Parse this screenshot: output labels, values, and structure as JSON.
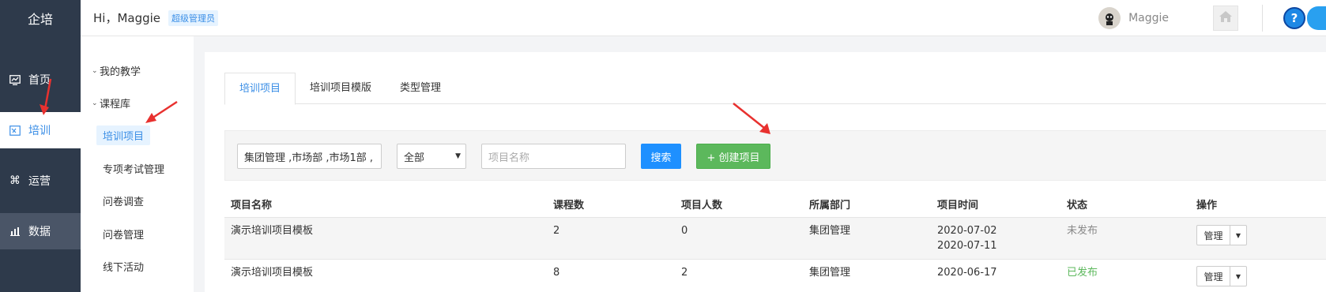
{
  "brand": "企培",
  "header": {
    "greeting": "Hi，Maggie",
    "role_badge": "超级管理员",
    "username": "Maggie"
  },
  "leftnav": {
    "items": [
      {
        "label": "首页",
        "icon": "chart-icon"
      },
      {
        "label": "培训",
        "icon": "training-icon"
      },
      {
        "label": "运营",
        "icon": "command-icon"
      },
      {
        "label": "数据",
        "icon": "bar-chart-icon"
      }
    ]
  },
  "subnav": {
    "groups": [
      "我的教学",
      "课程库"
    ],
    "items": [
      "培训项目",
      "专项考试管理",
      "问卷调查",
      "问卷管理",
      "线下活动"
    ]
  },
  "tabs": [
    "培训项目",
    "培训项目模版",
    "类型管理"
  ],
  "filters": {
    "department_value": "集团管理 ,市场部 ,市场1部 ,",
    "status_value": "全部",
    "project_name_placeholder": "项目名称",
    "search_label": "搜索",
    "create_label": "+ 创建项目"
  },
  "table": {
    "headers": [
      "项目名称",
      "课程数",
      "项目人数",
      "所属部门",
      "项目时间",
      "状态",
      "操作"
    ],
    "rows": [
      {
        "name": "演示培训项目模板",
        "courses": "2",
        "people": "0",
        "dept": "集团管理",
        "time_start": "2020-07-02",
        "time_end": "2020-07-11",
        "status": "未发布",
        "action": "管理"
      },
      {
        "name": "演示培训项目模板",
        "courses": "8",
        "people": "2",
        "dept": "集团管理",
        "time_start": "2020-06-17",
        "status": "已发布",
        "action": "管理"
      }
    ]
  },
  "colors": {
    "nav_bg": "#2e3a4b",
    "accent": "#3a8ee6",
    "search_btn": "#1e90ff",
    "create_btn": "#5cb85c",
    "annotation_arrow": "#e8312f"
  }
}
